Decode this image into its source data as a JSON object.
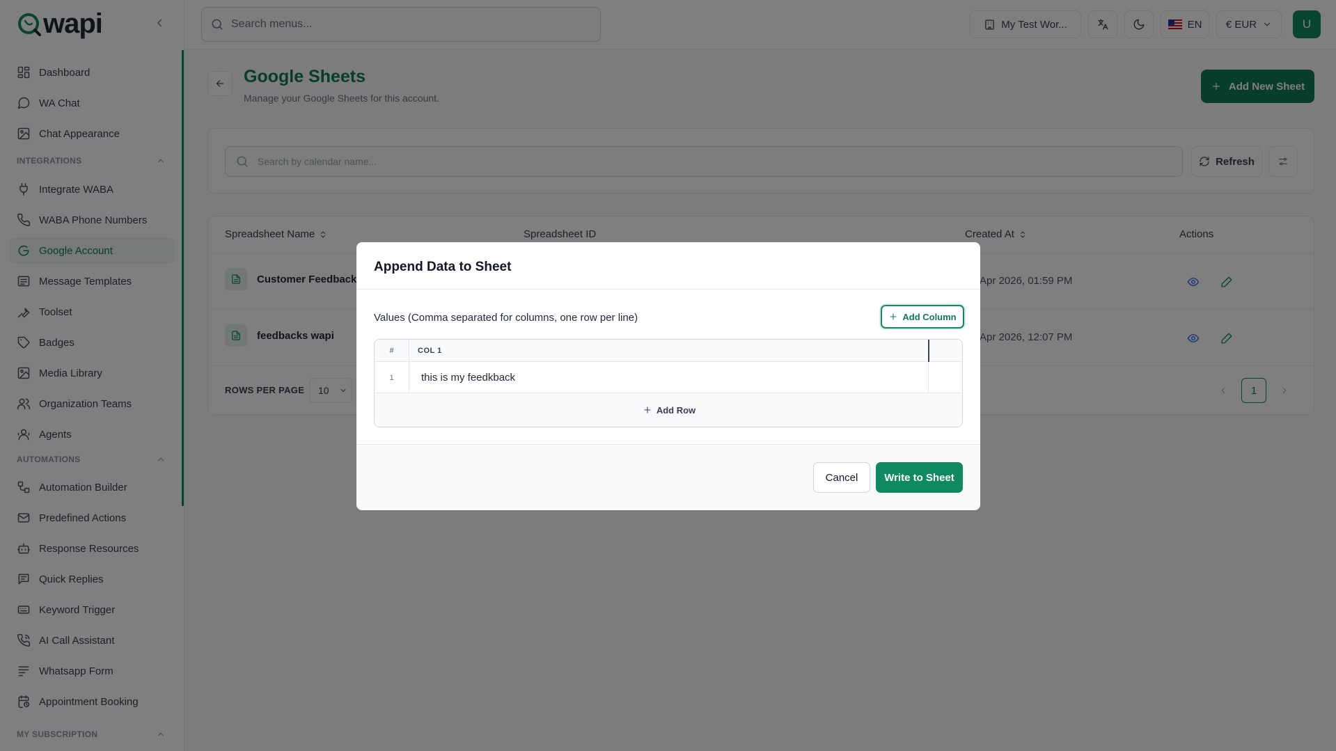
{
  "brand": {
    "name": "wapi",
    "accent": "#0f8a5f"
  },
  "topbar": {
    "search_placeholder": "Search menus...",
    "workspace": "My Test Wor...",
    "language": "EN",
    "currency": "€ EUR",
    "user_initial": "U"
  },
  "sidebar": {
    "items": [
      {
        "label": "Dashboard",
        "icon": "grid-icon"
      },
      {
        "label": "WA Chat",
        "icon": "chat-bubble-icon"
      },
      {
        "label": "Chat Appearance",
        "icon": "image-icon"
      }
    ],
    "sections": [
      {
        "title": "INTEGRATIONS",
        "items": [
          {
            "label": "Integrate WABA",
            "icon": "plug-icon"
          },
          {
            "label": "WABA Phone Numbers",
            "icon": "phone-icon"
          },
          {
            "label": "Google Account",
            "icon": "google-icon",
            "active": true
          },
          {
            "label": "Message Templates",
            "icon": "template-icon"
          },
          {
            "label": "Toolset",
            "icon": "wrench-icon"
          },
          {
            "label": "Badges",
            "icon": "tag-icon"
          },
          {
            "label": "Media Library",
            "icon": "image-icon"
          },
          {
            "label": "Organization Teams",
            "icon": "users-icon"
          },
          {
            "label": "Agents",
            "icon": "agent-icon"
          }
        ]
      },
      {
        "title": "AUTOMATIONS",
        "items": [
          {
            "label": "Automation Builder",
            "icon": "workflow-icon"
          },
          {
            "label": "Predefined Actions",
            "icon": "mail-icon"
          },
          {
            "label": "Response Resources",
            "icon": "bot-icon"
          },
          {
            "label": "Quick Replies",
            "icon": "message-lines-icon"
          },
          {
            "label": "Keyword Trigger",
            "icon": "key-icon"
          },
          {
            "label": "AI Call Assistant",
            "icon": "phone-call-icon"
          },
          {
            "label": "Whatsapp Form",
            "icon": "form-icon"
          },
          {
            "label": "Appointment Booking",
            "icon": "calendar-clock-icon"
          }
        ]
      },
      {
        "title": "MY SUBSCRIPTION",
        "items": []
      }
    ]
  },
  "page": {
    "title": "Google Sheets",
    "subtitle": "Manage your Google Sheets for this account.",
    "add_button": "Add New Sheet",
    "filter_placeholder": "Search by calendar name...",
    "refresh_label": "Refresh"
  },
  "table": {
    "columns": [
      "Spreadsheet Name",
      "Spreadsheet ID",
      "Created At",
      "Actions"
    ],
    "rows": [
      {
        "name": "Customer Feedback 2",
        "created": "Apr 2026, 01:59 PM"
      },
      {
        "name": "feedbacks wapi",
        "created": "Apr 2026, 12:07 PM"
      }
    ],
    "rows_per_page_label": "ROWS PER PAGE",
    "rows_per_page": "10",
    "current_page": "1"
  },
  "modal": {
    "title": "Append Data to Sheet",
    "values_label": "Values (Comma separated for columns, one row per line)",
    "add_column": "Add Column",
    "grid": {
      "hash_header": "#",
      "columns": [
        "COL 1"
      ],
      "rows": [
        {
          "num": "1",
          "cells": [
            "this is my feedkback"
          ]
        }
      ]
    },
    "add_row": "Add Row",
    "cancel": "Cancel",
    "submit": "Write to Sheet"
  }
}
